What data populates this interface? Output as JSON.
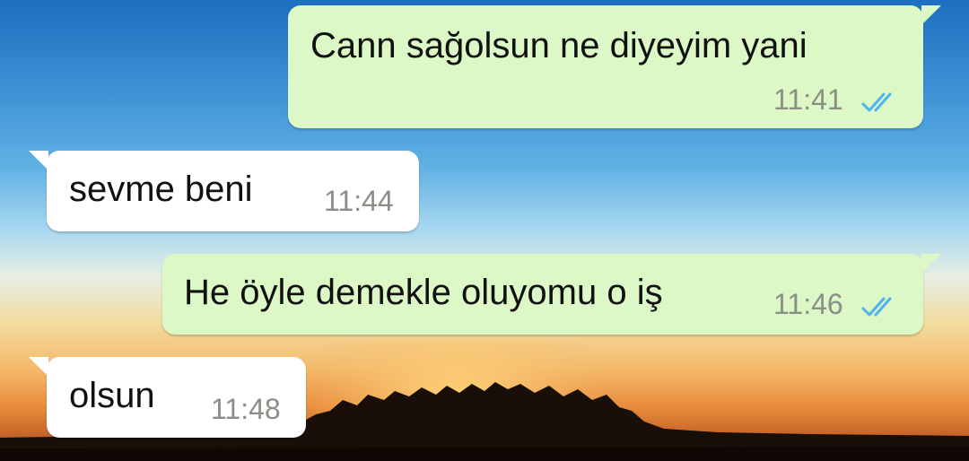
{
  "colors": {
    "outgoing_bubble": "#dcf8c6",
    "incoming_bubble": "#ffffff",
    "read_ticks": "#4fb3f0",
    "timestamp": "#8a8f86"
  },
  "messages": [
    {
      "direction": "outgoing",
      "text": "Cann sağolsun ne diyeyim yani",
      "time": "11:41",
      "status_icon": "double-check-read-icon"
    },
    {
      "direction": "incoming",
      "text": "sevme beni",
      "time": "11:44"
    },
    {
      "direction": "outgoing",
      "text": "He öyle demekle oluyomu o iş",
      "time": "11:46",
      "status_icon": "double-check-read-icon"
    },
    {
      "direction": "incoming",
      "text": "olsun",
      "time": "11:48"
    }
  ]
}
